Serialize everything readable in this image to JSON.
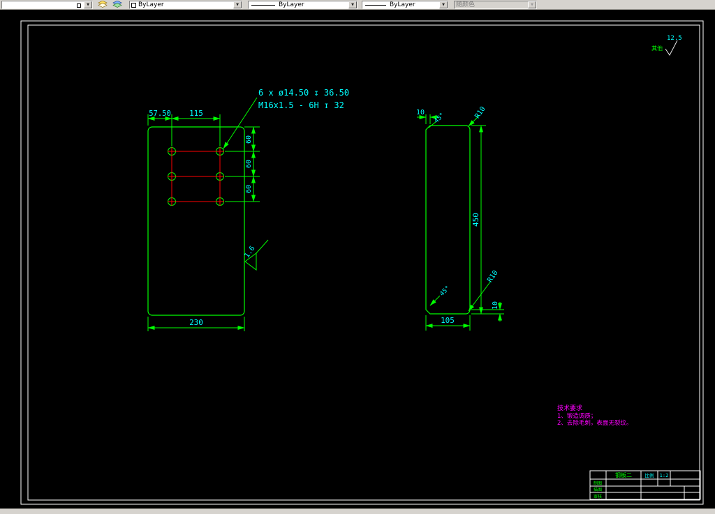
{
  "icons": {
    "dropdown_arrow": "▼"
  },
  "toolbar": {
    "layer": {
      "value": ""
    },
    "color": {
      "value": "ByLayer"
    },
    "linetype": {
      "value": "ByLayer"
    },
    "lineweight": {
      "value": "ByLayer"
    },
    "plotstyle": {
      "value": "随颜色"
    }
  },
  "drawing": {
    "front_view": {
      "note_line1": "6 x ø14.50 ↧ 36.50",
      "note_line2": "M16x1.5 - 6H ↧ 32",
      "dim_5750": "57.50",
      "dim_115": "115",
      "dim_60a": "60",
      "dim_60b": "60",
      "dim_60c": "60",
      "dim_230": "230",
      "roughness": "1.6"
    },
    "side_view": {
      "dim_10_top": "10",
      "chamfer_top": "45°",
      "r10_top": "R10",
      "dim_450": "450",
      "r10_bottom": "R10",
      "dim_10_bottom": "10",
      "chamfer_bottom": "45°",
      "dim_105": "105"
    },
    "general_roughness": {
      "prefix": "其他",
      "value": "12.5"
    },
    "tech_requirements": {
      "title": "技术要求",
      "item1": "1、锻造调质；",
      "item2": "2、去除毛刺，表面无裂纹。"
    },
    "title_block": {
      "part_name": "钢板二",
      "scale_label": "比例",
      "scale_value": "1:2",
      "row1": "制图",
      "row2": "描图",
      "row3": "审核"
    }
  }
}
